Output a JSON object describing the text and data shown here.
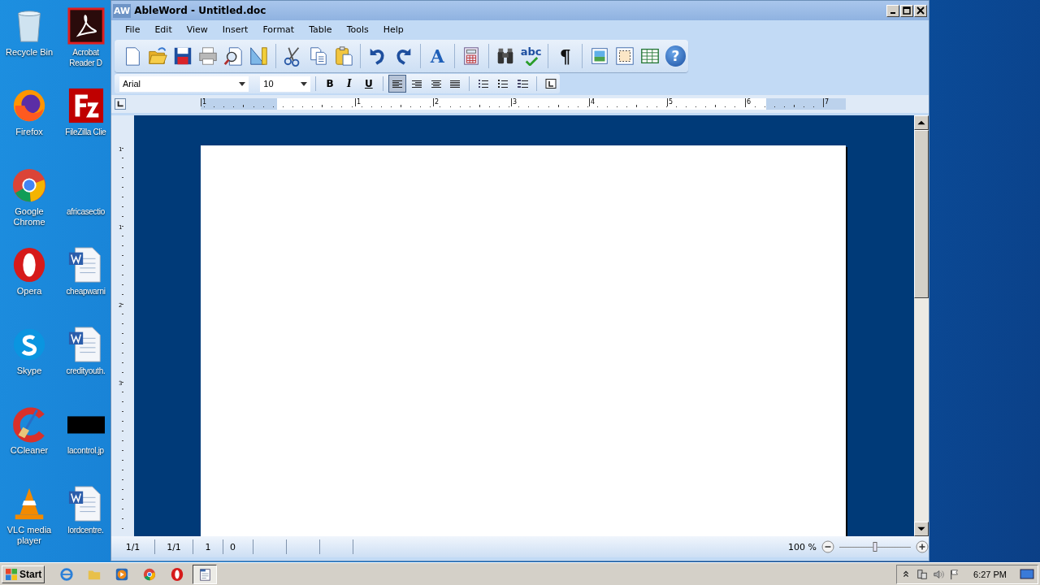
{
  "desktop_columns": [
    {
      "icons": [
        {
          "label": "Recycle Bin",
          "kind": "trash"
        },
        {
          "label": "Firefox",
          "kind": "firefox"
        },
        {
          "label": "Google Chrome",
          "kind": "chrome"
        },
        {
          "label": "Opera",
          "kind": "opera"
        },
        {
          "label": "Skype",
          "kind": "skype"
        },
        {
          "label": "CCleaner",
          "kind": "ccleaner"
        },
        {
          "label": "VLC media player",
          "kind": "vlc"
        }
      ]
    },
    {
      "icons": [
        {
          "label": "Acrobat Reader D",
          "kind": "pdf"
        },
        {
          "label": "FileZilla Clie",
          "kind": "filezilla"
        },
        {
          "label": "africasectio",
          "kind": "blank"
        },
        {
          "label": "cheapwarni",
          "kind": "word"
        },
        {
          "label": "credityouth.",
          "kind": "word"
        },
        {
          "label": "lacontrol.jp",
          "kind": "image"
        },
        {
          "label": "lordcentre.",
          "kind": "word"
        }
      ]
    }
  ],
  "window": {
    "app_badge": "AW",
    "title": "AbleWord - Untitled.doc"
  },
  "menu": [
    "File",
    "Edit",
    "View",
    "Insert",
    "Format",
    "Table",
    "Tools",
    "Help"
  ],
  "toolbar": [
    {
      "buttons": [
        {
          "kind": "new"
        },
        {
          "kind": "open"
        },
        {
          "kind": "save"
        },
        {
          "kind": "print"
        },
        {
          "kind": "preview"
        },
        {
          "kind": "setsquare"
        }
      ]
    },
    {
      "buttons": [
        {
          "kind": "cut"
        },
        {
          "kind": "copy"
        },
        {
          "kind": "paste"
        }
      ]
    },
    {
      "buttons": [
        {
          "kind": "undo"
        },
        {
          "kind": "redo"
        }
      ]
    },
    {
      "buttons": [
        {
          "kind": "font",
          "label": "A"
        }
      ]
    },
    {
      "buttons": [
        {
          "kind": "calc"
        }
      ]
    },
    {
      "buttons": [
        {
          "kind": "find"
        },
        {
          "kind": "spell",
          "label": "abc"
        }
      ]
    },
    {
      "buttons": [
        {
          "kind": "pilcrow",
          "label": "¶"
        }
      ]
    },
    {
      "buttons": [
        {
          "kind": "image"
        },
        {
          "kind": "frame"
        },
        {
          "kind": "table"
        },
        {
          "kind": "help",
          "label": "?"
        }
      ]
    }
  ],
  "format_bar": {
    "font": "Arial",
    "size": "10",
    "styles": [
      {
        "kind": "bold",
        "label": "B"
      },
      {
        "kind": "italic",
        "label": "I"
      },
      {
        "kind": "underline",
        "label": "U"
      }
    ],
    "align": [
      {
        "kind": "left",
        "selected": true
      },
      {
        "kind": "right",
        "selected": false
      },
      {
        "kind": "center",
        "selected": false
      },
      {
        "kind": "justify",
        "selected": false
      }
    ],
    "lists": [
      {
        "kind": "numbered"
      },
      {
        "kind": "bullets"
      },
      {
        "kind": "multilevel"
      }
    ]
  },
  "ruler": {
    "numbers": [
      "1",
      "1",
      "2",
      "3",
      "4",
      "5",
      "6",
      "7"
    ],
    "vertical_numbers": [
      "1",
      "1",
      "2",
      "3"
    ]
  },
  "status_bar": {
    "cells": [
      "1/1",
      "1/1",
      "1",
      "0"
    ],
    "zoom": "100 %",
    "zoom_level": {
      "level": 0.5
    }
  },
  "taskbar": {
    "start": "Start",
    "apps": [
      {
        "kind": "ie",
        "selected": false
      },
      {
        "kind": "folder",
        "selected": false
      },
      {
        "kind": "media",
        "selected": false
      },
      {
        "kind": "chrome",
        "selected": false
      },
      {
        "kind": "opera",
        "selected": false
      },
      {
        "kind": "ableword",
        "selected": true
      }
    ],
    "time": "6:27 PM"
  }
}
